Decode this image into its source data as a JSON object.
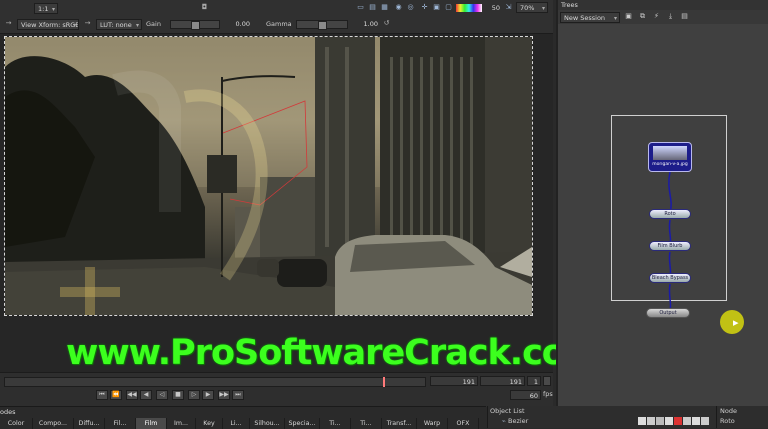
{
  "toolbar": {
    "frame_combo": "1:1",
    "view_xform": "View Xform: sRGB",
    "lut": "LUT: none",
    "gain_label": "Gain",
    "gain_value": "0.00",
    "gain_level": 0.5,
    "gamma_label": "Gamma",
    "gamma_value": "1.00",
    "gamma_level": 0.5,
    "proxy_value": "50",
    "zoom_value": "70%"
  },
  "viewer": {
    "watermark": "www.ProSoftwareCrack.com"
  },
  "timeline": {
    "current_frame": "191",
    "end_frame": "191",
    "step": "1",
    "fps_value": "60",
    "fps_label": "fps",
    "playhead_position": 0.9
  },
  "nodes_panel": {
    "title": "odes",
    "tabs": [
      "Color",
      "Compo...",
      "Diffu...",
      "Fil...",
      "Film",
      "Im...",
      "Key",
      "Li...",
      "Silhou...",
      "Specia...",
      "Ti...",
      "Ti...",
      "Transf...",
      "Warp",
      "OFX"
    ],
    "active_tab": "Film"
  },
  "object_list": {
    "title": "Object List",
    "item": "Bezier"
  },
  "node_panel": {
    "title": "Node",
    "item": "Roto"
  },
  "trees": {
    "title": "Trees",
    "session": "New Session",
    "nodes": [
      {
        "label": "morigan-v-a.jpg"
      },
      {
        "label": "Roto"
      },
      {
        "label": "Film Blurb"
      },
      {
        "label": "Bleach Bypass"
      },
      {
        "label": "Output"
      }
    ]
  },
  "colors": {
    "watermark": "#3cff1e",
    "node_edge": "#1a1aa8",
    "accent_yellow": "#d4d400"
  }
}
